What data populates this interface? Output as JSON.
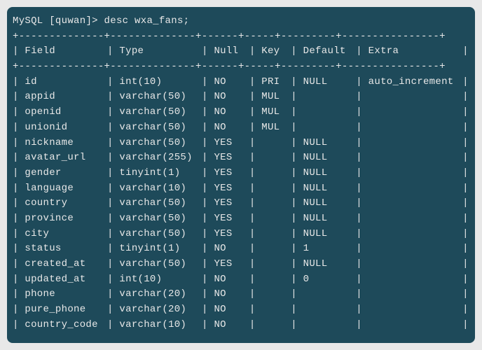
{
  "prompt": {
    "db_prefix": "MySQL [",
    "db_name": "quwan",
    "db_suffix": "]> ",
    "command": "desc wxa_fans;"
  },
  "divider_top": "+--------------+--------------+------+-----+---------+----------------+",
  "headers": {
    "field": "Field",
    "type": "Type",
    "null": "Null",
    "key": "Key",
    "default": "Default",
    "extra": "Extra"
  },
  "columns": [
    {
      "field": "id",
      "type": "int(10)",
      "null": "NO",
      "key": "PRI",
      "default": "NULL",
      "extra": "auto_increment"
    },
    {
      "field": "appid",
      "type": "varchar(50)",
      "null": "NO",
      "key": "MUL",
      "default": "",
      "extra": ""
    },
    {
      "field": "openid",
      "type": "varchar(50)",
      "null": "NO",
      "key": "MUL",
      "default": "",
      "extra": ""
    },
    {
      "field": "unionid",
      "type": "varchar(50)",
      "null": "NO",
      "key": "MUL",
      "default": "",
      "extra": ""
    },
    {
      "field": "nickname",
      "type": "varchar(50)",
      "null": "YES",
      "key": "",
      "default": "NULL",
      "extra": ""
    },
    {
      "field": "avatar_url",
      "type": "varchar(255)",
      "null": "YES",
      "key": "",
      "default": "NULL",
      "extra": ""
    },
    {
      "field": "gender",
      "type": "tinyint(1)",
      "null": "YES",
      "key": "",
      "default": "NULL",
      "extra": ""
    },
    {
      "field": "language",
      "type": "varchar(10)",
      "null": "YES",
      "key": "",
      "default": "NULL",
      "extra": ""
    },
    {
      "field": "country",
      "type": "varchar(50)",
      "null": "YES",
      "key": "",
      "default": "NULL",
      "extra": ""
    },
    {
      "field": "province",
      "type": "varchar(50)",
      "null": "YES",
      "key": "",
      "default": "NULL",
      "extra": ""
    },
    {
      "field": "city",
      "type": "varchar(50)",
      "null": "YES",
      "key": "",
      "default": "NULL",
      "extra": ""
    },
    {
      "field": "status",
      "type": "tinyint(1)",
      "null": "NO",
      "key": "",
      "default": "1",
      "extra": ""
    },
    {
      "field": "created_at",
      "type": "varchar(50)",
      "null": "YES",
      "key": "",
      "default": "NULL",
      "extra": ""
    },
    {
      "field": "updated_at",
      "type": "int(10)",
      "null": "NO",
      "key": "",
      "default": "0",
      "extra": ""
    },
    {
      "field": "phone",
      "type": "varchar(20)",
      "null": "NO",
      "key": "",
      "default": "",
      "extra": ""
    },
    {
      "field": "pure_phone",
      "type": "varchar(20)",
      "null": "NO",
      "key": "",
      "default": "",
      "extra": ""
    },
    {
      "field": "country_code",
      "type": "varchar(10)",
      "null": "NO",
      "key": "",
      "default": "",
      "extra": ""
    }
  ]
}
